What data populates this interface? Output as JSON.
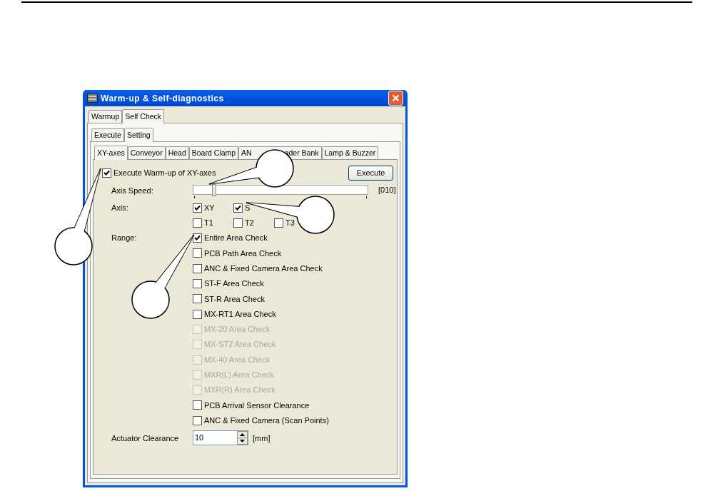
{
  "window": {
    "title": "Warm-up & Self-diagnostics"
  },
  "main_tabs": [
    {
      "label": "Warmup",
      "selected": false
    },
    {
      "label": "Self Check",
      "selected": true
    }
  ],
  "mode_tabs": [
    {
      "label": "Execute",
      "selected": false
    },
    {
      "label": "Setting",
      "selected": true
    }
  ],
  "unit_tabs": [
    {
      "label": "XY-axes",
      "selected": true
    },
    {
      "label": "Conveyor",
      "selected": false
    },
    {
      "label": "Head",
      "selected": false
    },
    {
      "label": "Board Clamp",
      "selected": false
    },
    {
      "label": "AN",
      "label_tail": "ader Bank",
      "selected": false
    },
    {
      "label": "Lamp & Buzzer",
      "selected": false
    }
  ],
  "execute_option": {
    "label": "Execute Warm-up of XY-axes",
    "checked": true
  },
  "execute_button": "Execute",
  "axis_speed": {
    "label": "Axis Speed:",
    "level": 0.11,
    "reading": "[010]"
  },
  "axis": {
    "label": "Axis:",
    "rows": [
      [
        {
          "label": "XY",
          "checked": true
        },
        {
          "label": "S",
          "checked": true
        }
      ],
      [
        {
          "label": "T1",
          "checked": false
        },
        {
          "label": "T2",
          "checked": false
        },
        {
          "label": "T3",
          "checked": false
        }
      ]
    ]
  },
  "range": {
    "label": "Range:",
    "options": [
      {
        "label": "Entire Area Check",
        "checked": true,
        "disabled": false
      },
      {
        "label": "PCB Path Area Check",
        "checked": false,
        "disabled": false
      },
      {
        "label": "ANC & Fixed Camera Area Check",
        "checked": false,
        "disabled": false
      },
      {
        "label": "ST-F Area Check",
        "checked": false,
        "disabled": false
      },
      {
        "label": "ST-R Area Check",
        "checked": false,
        "disabled": false
      },
      {
        "label": "MX-RT1 Area Check",
        "checked": false,
        "disabled": false
      },
      {
        "label": "MX-20 Area Check",
        "checked": false,
        "disabled": true
      },
      {
        "label": "MX-ST2 Area Check",
        "checked": false,
        "disabled": true
      },
      {
        "label": "MX-40 Area Check",
        "checked": false,
        "disabled": true
      },
      {
        "label": "MXR(L) Area Check",
        "checked": false,
        "disabled": true
      },
      {
        "label": "MXR(R) Area Check",
        "checked": false,
        "disabled": true
      },
      {
        "label": "PCB Arrival Sensor Clearance",
        "checked": false,
        "disabled": false
      },
      {
        "label": "ANC & Fixed Camera (Scan Points)",
        "checked": false,
        "disabled": false
      }
    ]
  },
  "actuator_clearance": {
    "label": "Actuator Clearance",
    "value": "10",
    "unit": "[mm]"
  }
}
